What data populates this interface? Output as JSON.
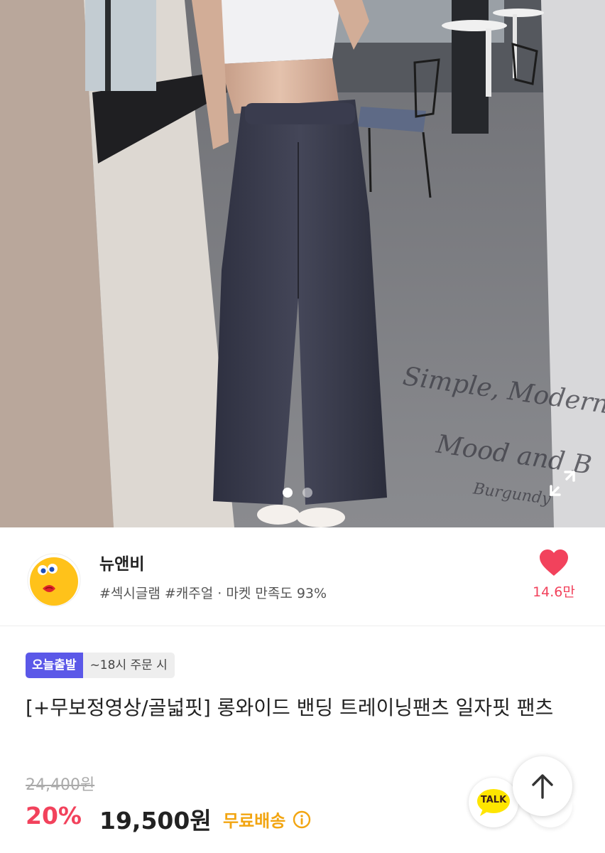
{
  "product_image": {
    "overlay_text_line1": "Simple, Modern",
    "overlay_text_line2": "Mood and B",
    "overlay_text_line3": "Burgundy",
    "carousel_total": 2,
    "carousel_active": 1,
    "expand_icon": "expand-icon"
  },
  "seller": {
    "name": "뉴앤비",
    "tags_meta": "#섹시글램 #캐주얼 · 마켓 만족도 93%",
    "like_count": "14.6만",
    "like_icon": "heart-icon",
    "like_color": "#f2425c"
  },
  "product": {
    "badge_label": "오늘출발",
    "badge_note": "~18시 주문 시",
    "title": "[+무보정영상/골넓핏] 롱와이드 밴딩 트레이닝팬츠 일자핏 팬츠",
    "original_price": "24,400원",
    "discount": "20%",
    "price": "19,500원",
    "shipping": "무료배송",
    "shipping_icon": "info-icon"
  },
  "floating": {
    "talk_label": "TALK",
    "top_icon": "arrow-up-icon"
  },
  "colors": {
    "accent_pink": "#f2425c",
    "badge_purple": "#5b58e8",
    "shipping_orange": "#f2a511",
    "talk_yellow": "#fee500"
  }
}
